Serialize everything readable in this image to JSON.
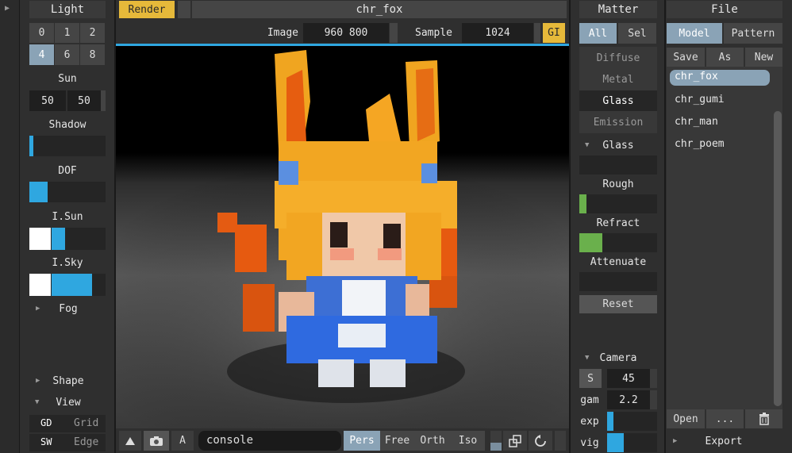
{
  "left_panel": {
    "title": "Light",
    "light_buttons": [
      "0",
      "1",
      "2",
      "4",
      "6",
      "8"
    ],
    "sun_label": "Sun",
    "sun_values": [
      "50",
      "50"
    ],
    "sliders": [
      {
        "label": "Shadow",
        "value": 0.05
      },
      {
        "label": "DOF",
        "value": 0.24
      },
      {
        "label": "I.Sun",
        "value": 0.46
      },
      {
        "label": "I.Sky",
        "value": 0.8
      }
    ],
    "fog_label": "Fog",
    "shape_label": "Shape",
    "view_label": "View",
    "view_rows": [
      {
        "key": "GD",
        "label": "Grid"
      },
      {
        "key": "SW",
        "label": "Edge"
      }
    ]
  },
  "top_bar": {
    "render_button": "Render",
    "title": "chr_fox",
    "image_label": "Image",
    "image_value": "960 800",
    "sample_label": "Sample",
    "sample_value": "1024",
    "gi_button": "GI"
  },
  "bottom_bar": {
    "console": "console",
    "a_button": "A",
    "views": [
      "Pers",
      "Free",
      "Orth",
      "Iso"
    ]
  },
  "matter_panel": {
    "title": "Matter",
    "tabs": [
      "All",
      "Sel"
    ],
    "materials": [
      "Diffuse",
      "Metal",
      "Glass",
      "Emission"
    ],
    "section": "Glass",
    "props": [
      {
        "label": "Rough",
        "value": 0.1
      },
      {
        "label": "Refract",
        "value": 0.3
      },
      {
        "label": "Attenuate",
        "value": 0.0
      }
    ],
    "reset": "Reset",
    "camera_label": "Camera",
    "camera_s_button": "S",
    "camera_fov": "45",
    "gam_label": "gam",
    "gam_value": "2.2",
    "exp_label": "exp",
    "exp_value": 0.1,
    "vig_label": "vig",
    "vig_value": 0.3
  },
  "file_panel": {
    "title": "File",
    "tabs": [
      "Model",
      "Pattern"
    ],
    "actions": [
      "Save",
      "As",
      "New"
    ],
    "files": [
      "chr_fox",
      "chr_gumi",
      "chr_man",
      "chr_poem"
    ],
    "bottom_actions": [
      "Open",
      "..."
    ],
    "export_label": "Export"
  },
  "colors": {
    "accent_blue": "#2fa7e0",
    "accent_yellow": "#e6b93a",
    "accent_green": "#6ab04c",
    "selected_tab": "#8aa3b6"
  }
}
